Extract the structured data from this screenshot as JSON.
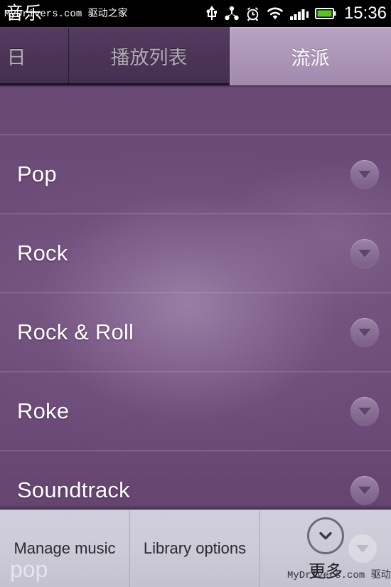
{
  "status_bar": {
    "app_title": "音乐",
    "clock": "15:36",
    "icons": [
      "usb-icon",
      "share-icon",
      "alarm-icon",
      "wifi-icon",
      "signal-icon",
      "battery-icon"
    ],
    "battery_color": "#5ac22a"
  },
  "tabs": [
    {
      "label": "日",
      "active": false,
      "name": "tab-albums"
    },
    {
      "label": "播放列表",
      "active": false,
      "name": "tab-playlists"
    },
    {
      "label": "流派",
      "active": true,
      "name": "tab-genres"
    }
  ],
  "list": {
    "chevron_icon": "chevron-down-circle-icon",
    "items": [
      {
        "label": ""
      },
      {
        "label": "Pop"
      },
      {
        "label": "Rock"
      },
      {
        "label": "Rock & Roll"
      },
      {
        "label": "Roke"
      },
      {
        "label": "Soundtrack"
      }
    ]
  },
  "options_menu": {
    "items": [
      {
        "label": "Manage music",
        "name": "menu-item-manage-music",
        "icon": null
      },
      {
        "label": "Library options",
        "name": "menu-item-library-options",
        "icon": null
      },
      {
        "label": "更多",
        "name": "menu-item-more",
        "icon": "chevron-down-circle-icon"
      }
    ],
    "ghost_text": "pop"
  },
  "watermarks": {
    "top": "MyDrivers.com 驱动之家",
    "bottom": "MyDrivers.com 驱动之家"
  },
  "colors": {
    "accent_purple": "#6d4b78",
    "tab_active": "#ad96b8",
    "tab_inactive": "#4d3558",
    "menu_bg": "#ccc9d6",
    "status_bg": "#000000"
  }
}
